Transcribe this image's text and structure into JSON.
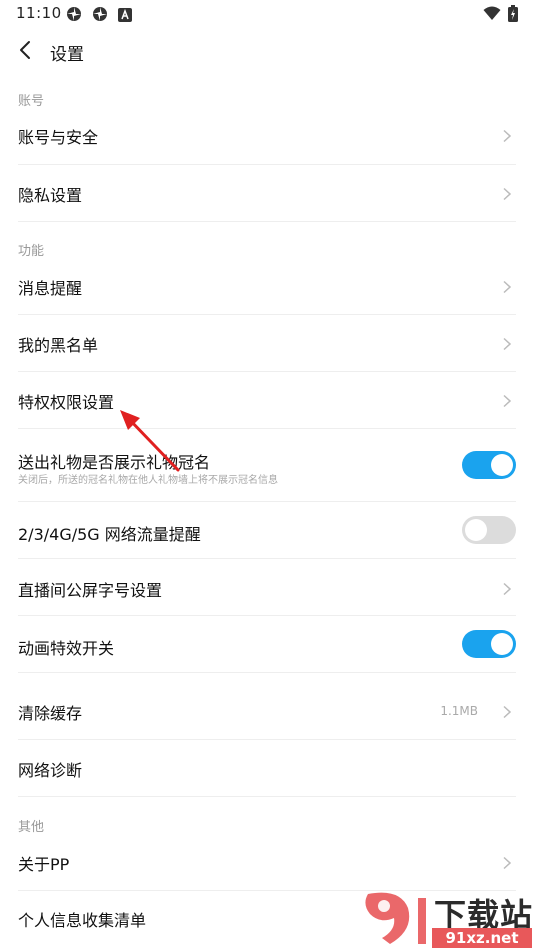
{
  "status_bar": {
    "time": "11:10",
    "icons": [
      "pinwheel-icon",
      "pinwheel-icon",
      "a-notification-icon",
      "wifi-icon",
      "battery-charging-icon"
    ]
  },
  "header": {
    "title": "设置",
    "back_icon": "back-arrow-icon"
  },
  "sections": {
    "account": {
      "title": "账号",
      "items": [
        {
          "label": "账号与安全"
        },
        {
          "label": "隐私设置"
        }
      ]
    },
    "features": {
      "title": "功能",
      "items": [
        {
          "label": "消息提醒"
        },
        {
          "label": "我的黑名单"
        },
        {
          "label": "特权权限设置"
        },
        {
          "label": "送出礼物是否展示礼物冠名",
          "subtitle": "关闭后，所送的冠名礼物在他人礼物墙上将不展示冠名信息",
          "toggle": true
        },
        {
          "label": "2/3/4G/5G 网络流量提醒",
          "toggle": false
        },
        {
          "label": "直播间公屏字号设置"
        },
        {
          "label": "动画特效开关",
          "toggle": true
        },
        {
          "label": "清除缓存",
          "value": "1.1MB"
        },
        {
          "label": "网络诊断"
        }
      ]
    },
    "other": {
      "title": "其他",
      "items": [
        {
          "label": "关于PP"
        },
        {
          "label": "个人信息收集清单"
        }
      ]
    }
  },
  "watermark": {
    "brand": "下载站",
    "domain": "91xz.net"
  },
  "colors": {
    "toggle_on": "#1aa3ee",
    "toggle_off": "#dcdcdc",
    "annotation_arrow": "#e02020"
  }
}
